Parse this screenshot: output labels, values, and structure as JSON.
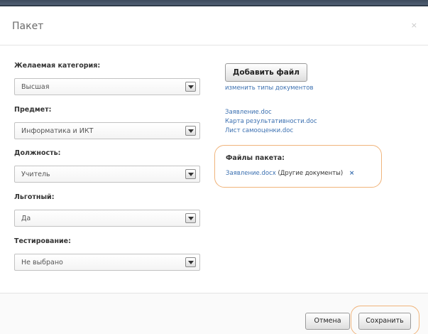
{
  "dialog": {
    "title": "Пакет",
    "close_glyph": "×"
  },
  "form": {
    "fields": [
      {
        "label": "Желаемая категория:",
        "value": "Высшая"
      },
      {
        "label": "Предмет:",
        "value": "Информатика и ИКТ"
      },
      {
        "label": "Должность:",
        "value": "Учитель"
      },
      {
        "label": "Льготный:",
        "value": "Да"
      },
      {
        "label": "Тестирование:",
        "value": "Не выбрано"
      }
    ]
  },
  "documents": {
    "add_file_label": "Добавить файл",
    "change_types_link": "изменить типы документов",
    "files": [
      "Заявление.doc",
      "Карта результативности.doc",
      "Лист самооценки.doc"
    ]
  },
  "package": {
    "title": "Файлы пакета:",
    "file_name": "Заявление.docx",
    "file_note": "(Другие документы)",
    "remove_glyph": "×"
  },
  "footer": {
    "cancel_label": "Отмена",
    "save_label": "Сохранить"
  },
  "colors": {
    "link": "#3a6fb0",
    "highlight": "#f0b47b",
    "topbar": "#3d4b5c"
  }
}
